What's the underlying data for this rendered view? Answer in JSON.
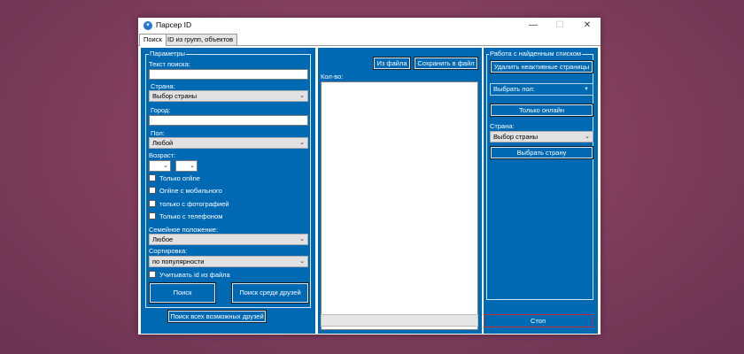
{
  "window": {
    "title": "Парсер ID",
    "controls": {
      "minimize": "—",
      "maximize": "☐",
      "close": "✕"
    }
  },
  "tabs": [
    {
      "label": "Поиск",
      "active": true
    },
    {
      "label": "ID из групп, объектов",
      "active": false
    }
  ],
  "params": {
    "group_title": "Параметры",
    "search_text_label": "Текст поиска:",
    "search_text_value": "",
    "country_label": "Страна:",
    "country_value": "Выбор страны",
    "city_label": "Город:",
    "city_value": "",
    "sex_label": "Пол:",
    "sex_value": "Любой",
    "age_label": "Возраст:",
    "age_from": "",
    "age_to": "",
    "checkboxes": [
      {
        "label": "Только online",
        "checked": false
      },
      {
        "label": "Online с мобильного",
        "checked": false
      },
      {
        "label": "только с фотографией",
        "checked": false
      },
      {
        "label": "Только с телефоном",
        "checked": false
      }
    ],
    "marital_label": "Семейное положение:",
    "marital_value": "Любое",
    "sort_label": "Сортировка:",
    "sort_value": "по популярности",
    "use_file_ids": {
      "label": "Учитывать id из файла",
      "checked": false
    },
    "search_button": "Поиск",
    "search_friends_button": "Поиск среди друзей"
  },
  "search_all_friends_button": "Поиск всех возможных друзей",
  "middle": {
    "from_file_button": "Из файла",
    "save_file_button": "Сохранить в файл",
    "count_label": "Кол-во:"
  },
  "right": {
    "group_title": "Работа с найденным списком",
    "delete_inactive_button": "Удалить неактивные страницы",
    "choose_sex_value": "Выбрать пол:",
    "only_online_button": "Только онлайн",
    "country_label": "Страна:",
    "country_value": "Выбор страны",
    "choose_country_button": "Выбрать страну",
    "stop_button": "Стоп"
  },
  "colors": {
    "panel_blue": "#0069b4",
    "stop_border": "#c42b35"
  }
}
